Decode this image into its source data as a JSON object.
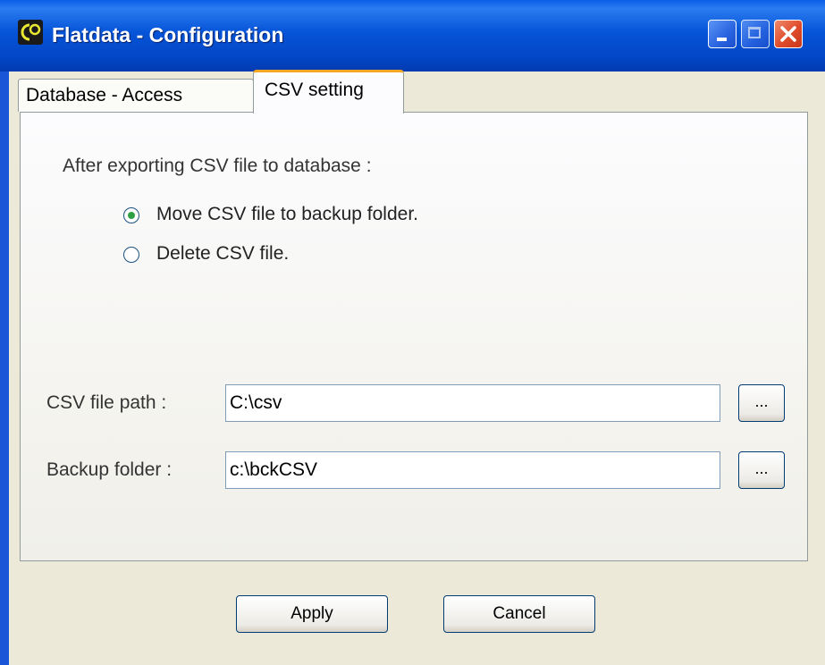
{
  "window": {
    "title": "Flatdata - Configuration"
  },
  "tabs": [
    {
      "label": "Database - Access",
      "selected": false
    },
    {
      "label": "CSV setting",
      "selected": true
    }
  ],
  "csv_setting": {
    "heading": "After exporting CSV file to database :",
    "options": [
      {
        "label": "Move CSV file to backup folder.",
        "checked": true
      },
      {
        "label": "Delete CSV file.",
        "checked": false
      }
    ],
    "csv_path": {
      "label": "CSV file path :",
      "value": "C:\\csv",
      "browse_label": "..."
    },
    "backup_folder": {
      "label": "Backup folder :",
      "value": "c:\\bckCSV",
      "browse_label": "..."
    }
  },
  "buttons": {
    "apply": "Apply",
    "cancel": "Cancel"
  },
  "colors": {
    "titlebar": "#0654d8",
    "active_tab_accent": "#f5a623",
    "radio_dot": "#2ea043"
  }
}
